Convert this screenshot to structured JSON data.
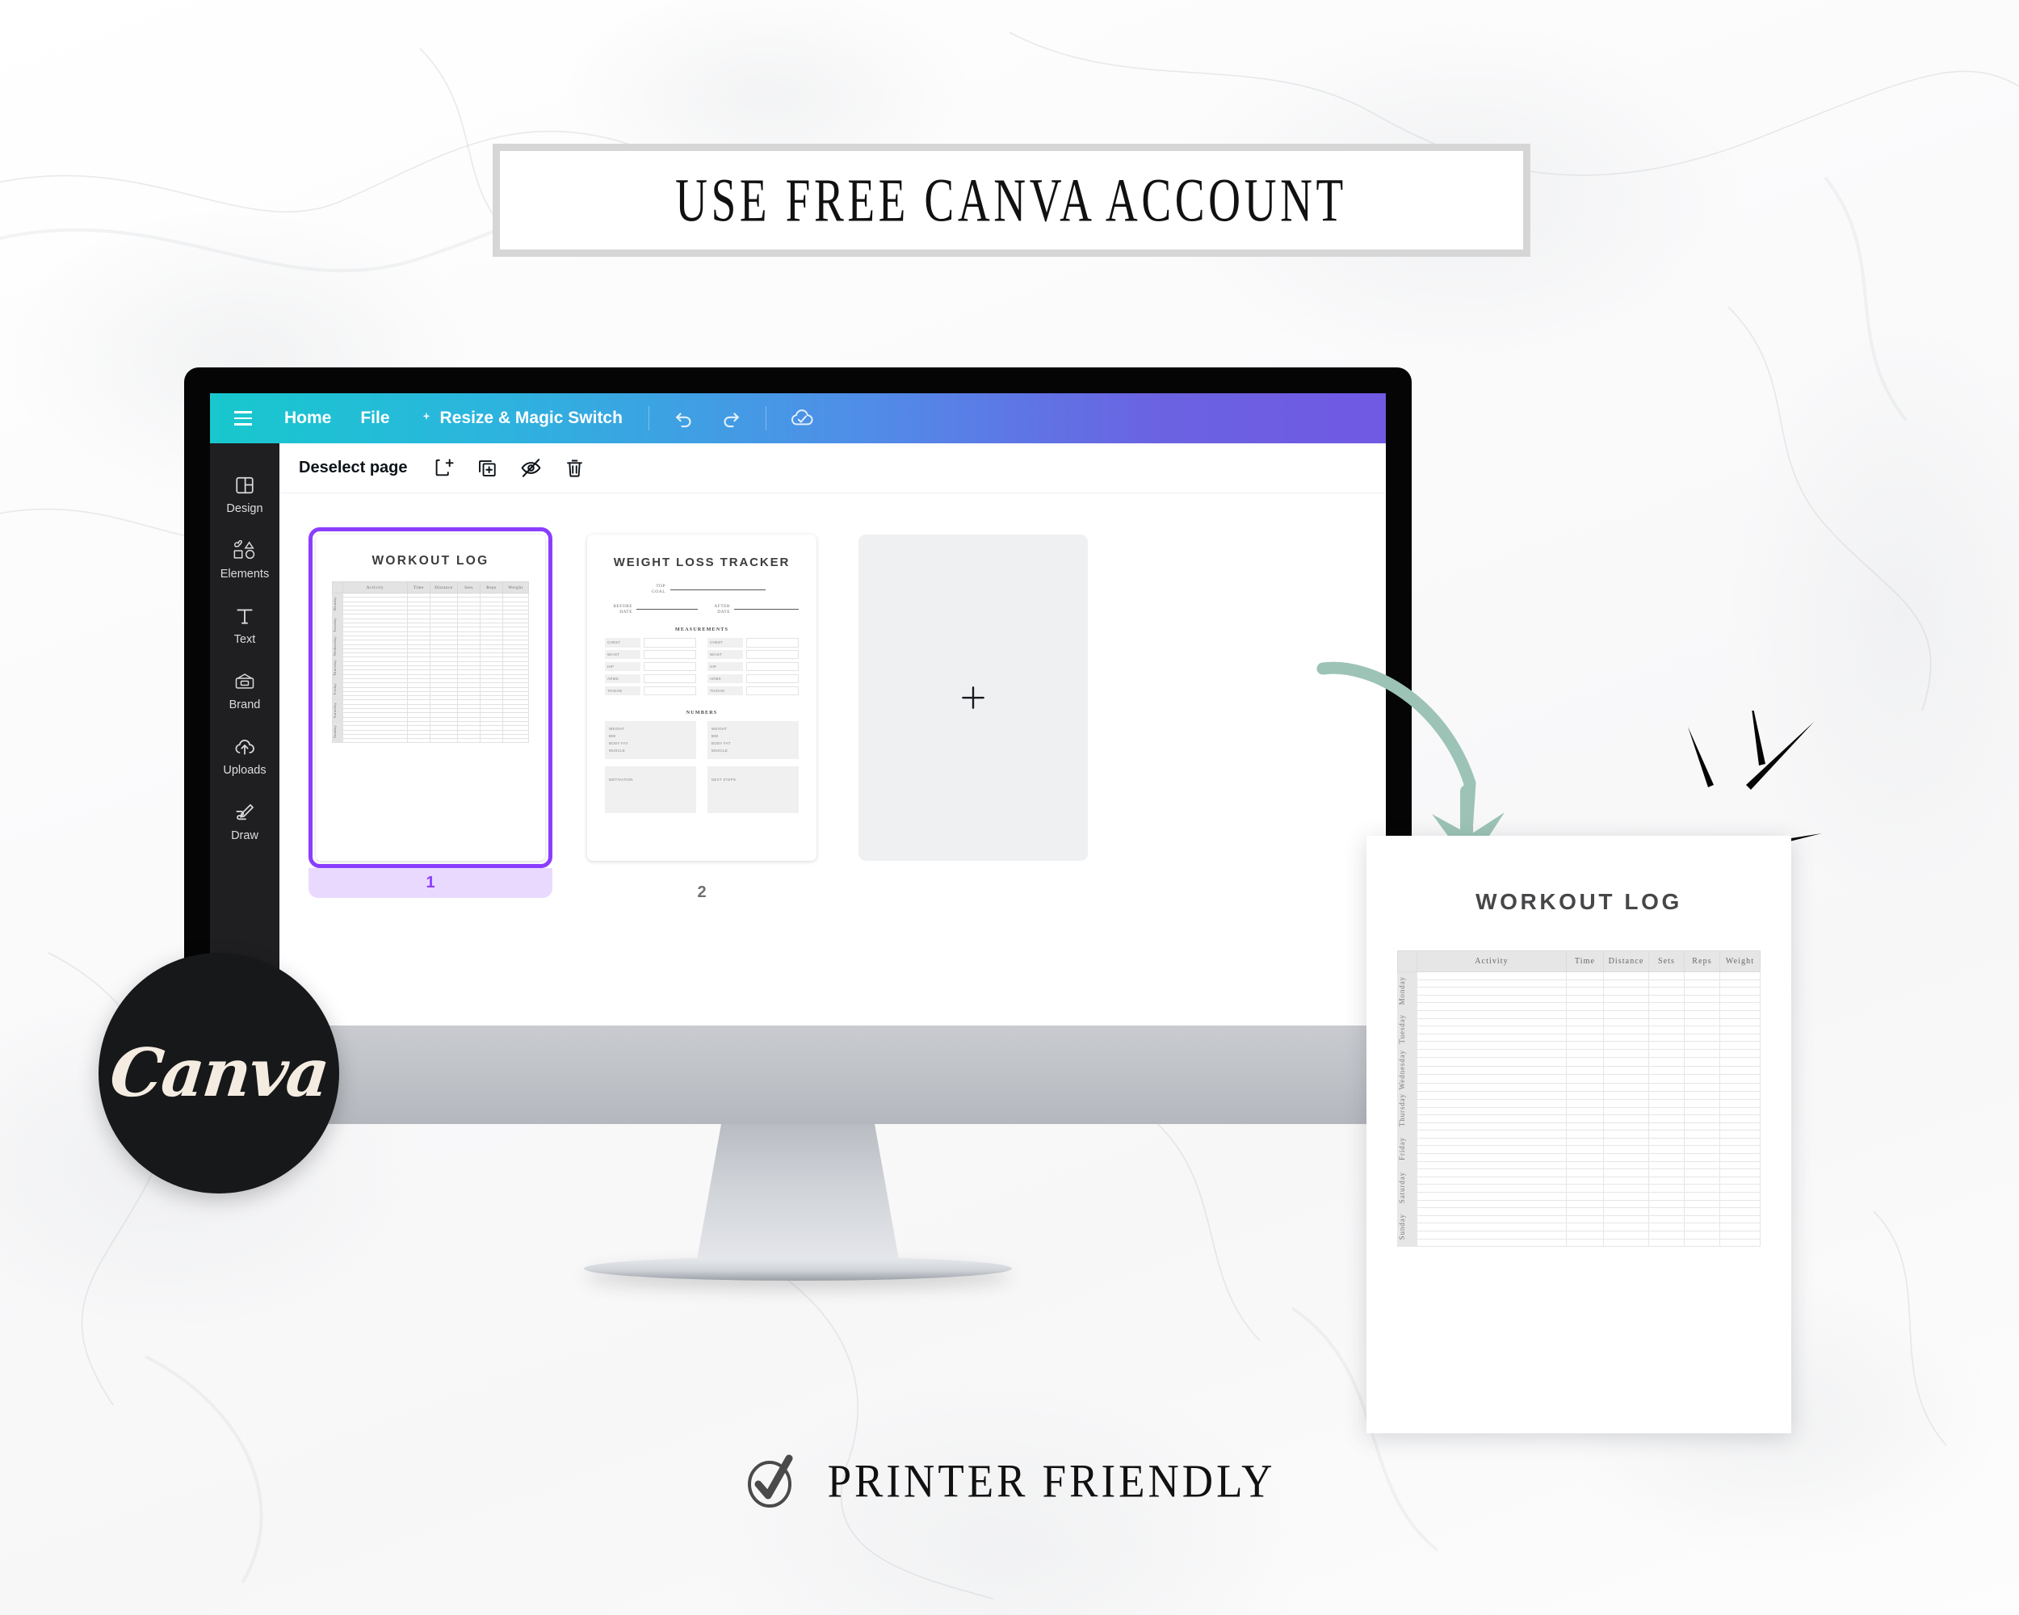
{
  "banner": {
    "text": "USE FREE CANVA ACCOUNT"
  },
  "footer": {
    "text": "PRINTER FRIENDLY",
    "icon": "circle-check-icon"
  },
  "badge": {
    "brand": "Canva"
  },
  "topbar": {
    "menu_icon": "hamburger-menu-icon",
    "items": [
      {
        "label": "Home",
        "icon": ""
      },
      {
        "label": "File",
        "icon": ""
      },
      {
        "label": "Resize & Magic Switch",
        "icon": "magic-wand-icon"
      }
    ],
    "undo_icon": "undo-icon",
    "redo_icon": "redo-icon",
    "cloud_icon": "cloud-saved-icon"
  },
  "sidebar": {
    "items": [
      {
        "label": "Design",
        "icon": "layout-panels-icon"
      },
      {
        "label": "Elements",
        "icon": "shapes-icon"
      },
      {
        "label": "Text",
        "icon": "text-t-icon"
      },
      {
        "label": "Brand",
        "icon": "brand-card-icon"
      },
      {
        "label": "Uploads",
        "icon": "cloud-upload-icon"
      },
      {
        "label": "Draw",
        "icon": "pen-draw-icon"
      }
    ]
  },
  "pagebar": {
    "deselect_label": "Deselect page",
    "actions": [
      {
        "name": "add-page",
        "icon": "add-page-icon"
      },
      {
        "name": "duplicate-page",
        "icon": "duplicate-page-icon"
      },
      {
        "name": "hide-page",
        "icon": "eye-slash-icon"
      },
      {
        "name": "delete-page",
        "icon": "trash-icon"
      }
    ]
  },
  "pages": {
    "selected_index": 1,
    "page1": {
      "number": "1",
      "title": "WORKOUT LOG",
      "columns": [
        "Activity",
        "Time",
        "Distance",
        "Sets",
        "Reps",
        "Weight"
      ],
      "days": [
        "Monday",
        "Tuesday",
        "Wednesday",
        "Thursday",
        "Friday",
        "Saturday",
        "Sunday"
      ],
      "rows_per_day": 5
    },
    "page2": {
      "number": "2",
      "title": "WEIGHT LOSS TRACKER",
      "top_goal_label": "TOP\nGOAL",
      "before_label": "BEFORE\nDATE",
      "after_label": "AFTER\nDATE",
      "measurements_heading": "MEASUREMENTS",
      "measurement_labels": [
        "CHEST",
        "WAIST",
        "HIP",
        "ARMS",
        "THIGHS"
      ],
      "numbers_heading": "NUMBERS",
      "number_labels": [
        "WEIGHT",
        "BMI",
        "BODY FAT",
        "MUSCLE"
      ],
      "motivation_label": "MOTIVATION",
      "next_steps_label": "NEXT STEPS"
    },
    "add_page": {
      "icon": "plus-icon",
      "label": "+"
    }
  },
  "document_preview": {
    "title": "WORKOUT LOG",
    "columns": [
      "Activity",
      "Time",
      "Distance",
      "Sets",
      "Reps",
      "Weight"
    ],
    "days": [
      "Monday",
      "Tuesday",
      "Wednesday",
      "Thursday",
      "Friday",
      "Saturday",
      "Sunday"
    ],
    "rows_per_day": 5
  },
  "decor": {
    "arrow_icon": "curved-arrow-down-icon",
    "sparkle_icon": "sparkle-burst-icon"
  },
  "colors": {
    "accent_purple": "#8b3dff",
    "topbar_teal": "#17c8cd",
    "topbar_purple": "#7059e3",
    "sage_arrow": "#9cc3b6",
    "sidebar_dark": "#1f1f21",
    "badge_dark": "#17181a",
    "badge_cream": "#f5ece1"
  }
}
